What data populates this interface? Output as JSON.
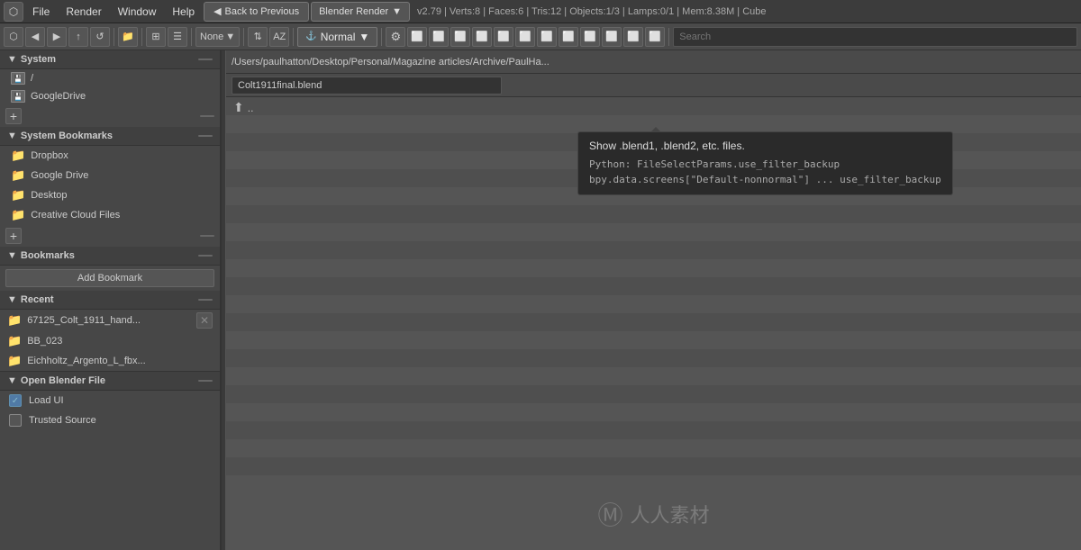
{
  "menubar": {
    "icon_label": "⬡",
    "items": [
      "File",
      "Render",
      "Window",
      "Help"
    ],
    "back_btn": "Back to Previous",
    "renderer": "Blender Render",
    "info": "v2.79 | Verts:8 | Faces:6 | Tris:12 | Objects:1/3 | Lamps:0/1 | Mem:8.38M | Cube"
  },
  "toolbar": {
    "nav_icons": [
      "◀",
      "▶",
      "↑",
      "↺"
    ],
    "view_icons": [
      "⊞",
      "☰"
    ],
    "sort_icons": [
      "⇅"
    ],
    "display_select": "None",
    "normal_select": "Normal",
    "filter_icons": [
      "⚙",
      "🔳",
      "📋",
      "🔲",
      "🔲",
      "🔲"
    ],
    "search_placeholder": "Search"
  },
  "sidebar": {
    "system_section": {
      "title": "System",
      "items": [
        {
          "label": "/",
          "type": "drive"
        },
        {
          "label": "GoogleDrive",
          "type": "drive"
        }
      ]
    },
    "system_bookmarks_section": {
      "title": "System Bookmarks",
      "items": [
        {
          "label": "Dropbox",
          "type": "folder"
        },
        {
          "label": "Google Drive",
          "type": "folder"
        },
        {
          "label": "Desktop",
          "type": "folder"
        },
        {
          "label": "Creative Cloud Files",
          "type": "folder"
        }
      ]
    },
    "bookmarks_section": {
      "title": "Bookmarks",
      "add_bookmark_label": "Add Bookmark"
    },
    "recent_section": {
      "title": "Recent",
      "items": [
        {
          "label": "67125_Colt_1911_hand...",
          "show_close": true
        },
        {
          "label": "BB_023",
          "show_close": false
        },
        {
          "label": "Eichholtz_Argento_L_fbx...",
          "show_close": false
        }
      ]
    },
    "open_section": {
      "title": "Open Blender File",
      "load_ui": {
        "label": "Load UI",
        "checked": true
      },
      "trusted_source": {
        "label": "Trusted Source",
        "checked": false
      }
    }
  },
  "filebrowser": {
    "path": "/Users/paulhatton/Desktop/Personal/Magazine articles/Archive/PaulHa...",
    "filename": "Colt1911final.blend",
    "back_nav": ".."
  },
  "tooltip": {
    "title": "Show .blend1, .blend2, etc. files.",
    "line1": "Python: FileSelectParams.use_filter_backup",
    "line2": "bpy.data.screens[\"Default-nonnormal\"] ... use_filter_backup"
  },
  "watermark": {
    "text": "人人素材",
    "icon": "Ⓜ"
  }
}
